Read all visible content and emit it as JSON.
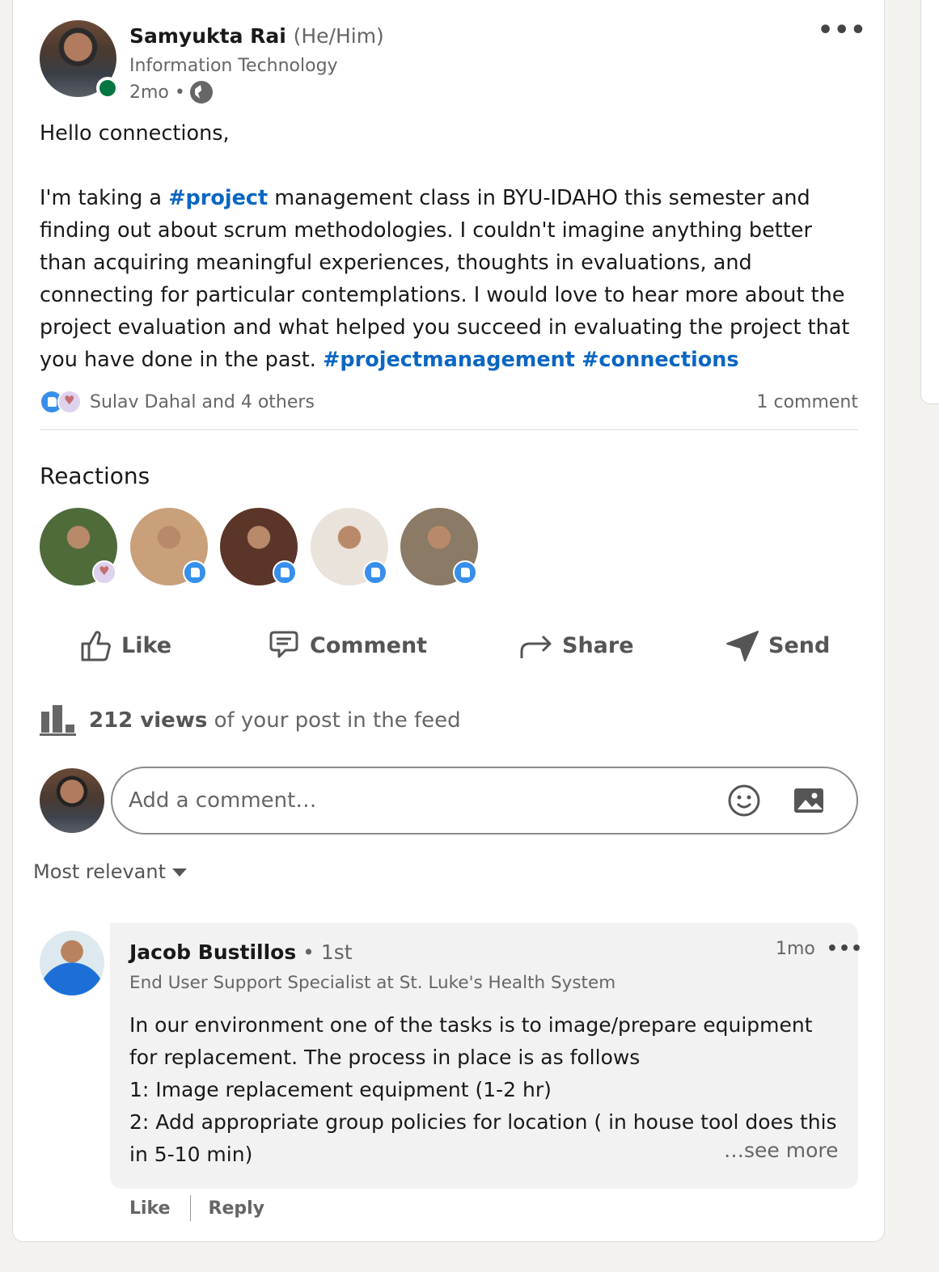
{
  "post": {
    "author": {
      "name": "Samyukta Rai",
      "pronouns": "(He/Him)",
      "headline": "Information Technology",
      "time": "2mo •"
    },
    "intro": "Hello connections,",
    "body_before": "I'm taking a ",
    "hashtag_1": "#project",
    "body_after": " management class in BYU-IDAHO this semester and finding out about scrum methodologies. I couldn't imagine anything better than acquiring meaningful experiences, thoughts in evaluations, and connecting for particular contemplations. I would love to hear more about the project evaluation and what helped you succeed in evaluating the project that you have done in the past. ",
    "hashtag_2": "#projectmanagement",
    "hashtag_3": "#connections",
    "reactors_summary": "Sulav Dahal and 4 others",
    "comment_count": "1 comment"
  },
  "reactions": {
    "title": "Reactions",
    "people": [
      {
        "reaction": "love",
        "bg": "#4f6b3a"
      },
      {
        "reaction": "like",
        "bg": "#c9a07a"
      },
      {
        "reaction": "like",
        "bg": "#5a3528"
      },
      {
        "reaction": "like",
        "bg": "#e9e3dc"
      },
      {
        "reaction": "like",
        "bg": "#8a7a66"
      }
    ]
  },
  "actions": {
    "like": "Like",
    "comment": "Comment",
    "share": "Share",
    "send": "Send"
  },
  "views": {
    "count": "212 views",
    "suffix": " of your post in the feed"
  },
  "comment_input": {
    "placeholder": "Add a comment…"
  },
  "sort": {
    "label": "Most relevant"
  },
  "comment": {
    "name": "Jacob Bustillos",
    "degree": " • 1st",
    "headline": "End User Support Specialist at St. Luke's Health System",
    "time": "1mo",
    "more": "•••",
    "lines": [
      "In our environment one of the tasks is to image/prepare equipment",
      "for replacement. The process in place is as follows",
      "1: Image replacement equipment (1-2 hr)",
      "2: Add appropriate group policies for location ( in house tool does this",
      "in 5-10 min)"
    ],
    "see_more": "…see more",
    "like": "Like",
    "reply": "Reply"
  },
  "colors": {
    "link": "#0a66c2",
    "online": "#057642",
    "like_badge": "#378fe9"
  }
}
